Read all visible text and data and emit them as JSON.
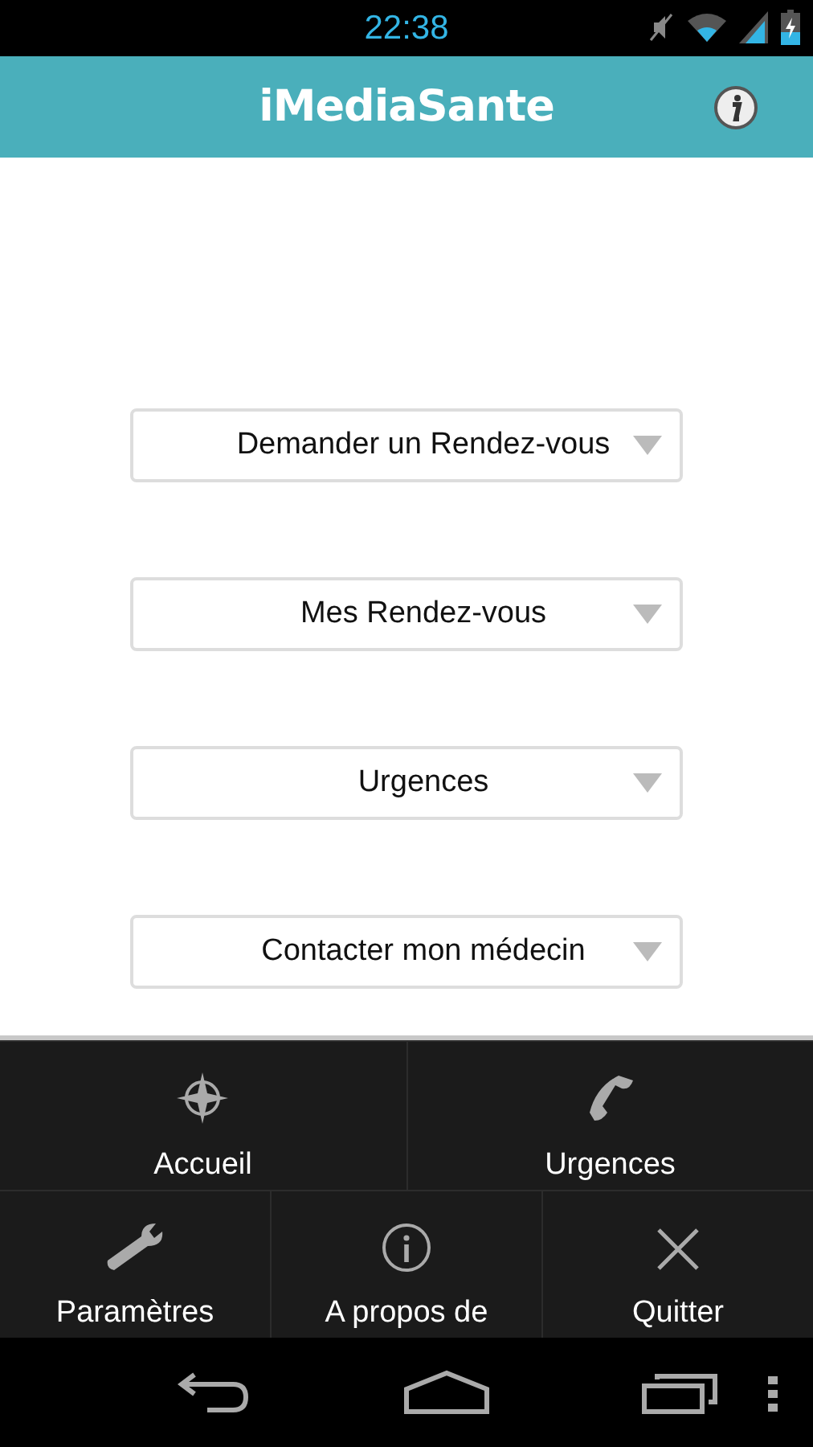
{
  "status_bar": {
    "time": "22:38"
  },
  "header": {
    "title": "iMediaSante"
  },
  "buttons": [
    {
      "label": "Demander un Rendez-vous"
    },
    {
      "label": "Mes Rendez-vous"
    },
    {
      "label": "Urgences"
    },
    {
      "label": "Contacter mon médecin"
    }
  ],
  "menu": {
    "rows": [
      [
        {
          "label": "Accueil",
          "kind": "compass"
        },
        {
          "label": "Urgences",
          "kind": "phone"
        }
      ],
      [
        {
          "label": "Paramètres",
          "kind": "wrench"
        },
        {
          "label": "A propos de",
          "kind": "info"
        },
        {
          "label": "Quitter",
          "kind": "close"
        }
      ]
    ]
  }
}
